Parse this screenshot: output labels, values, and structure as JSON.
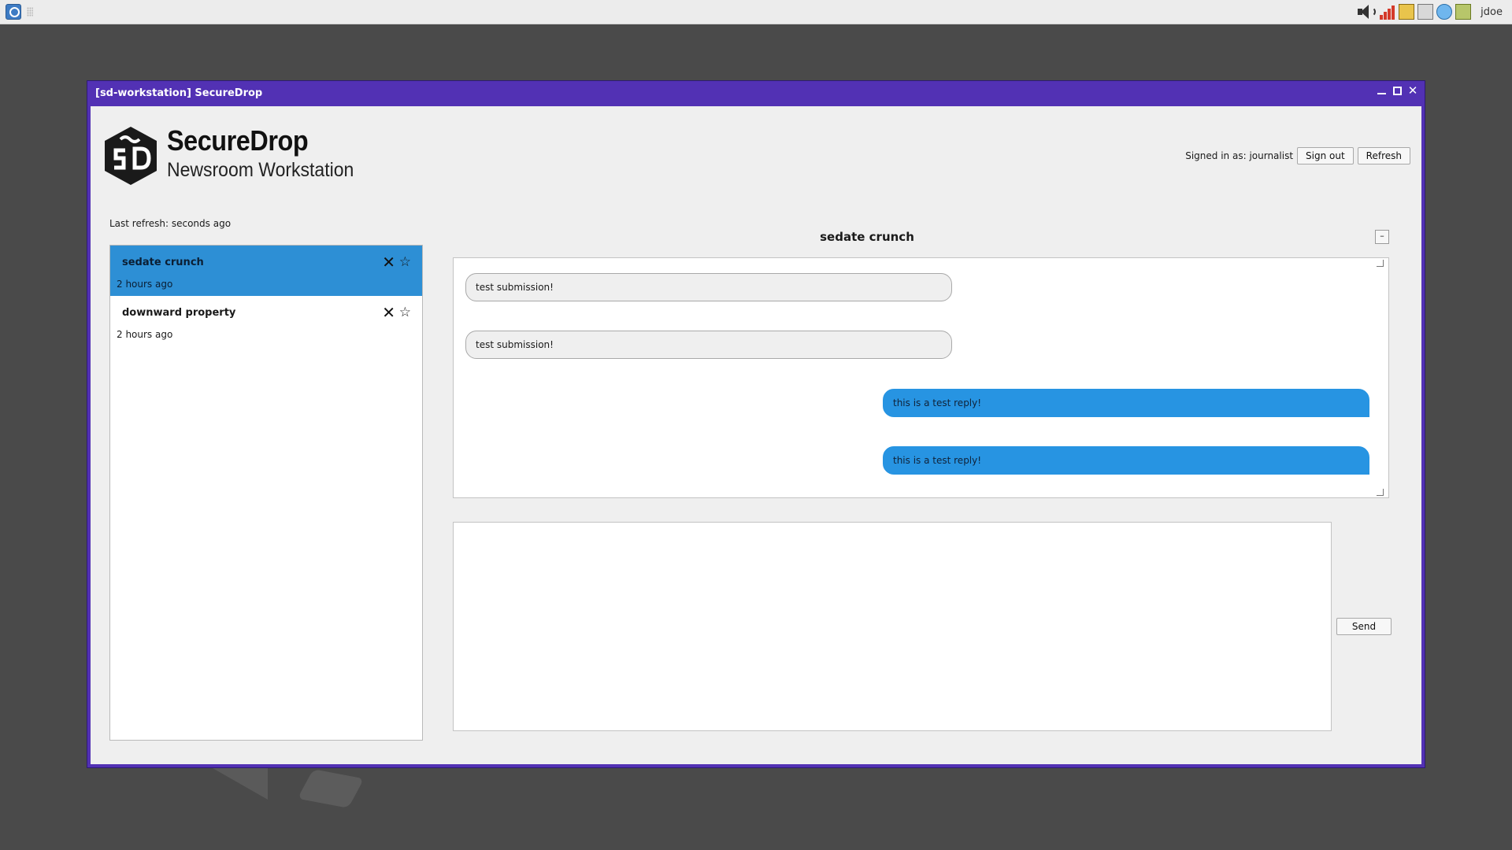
{
  "system_bar": {
    "user": "jdoe",
    "icons": [
      "qubes-launcher-icon",
      "volume-icon",
      "network-bars-icon",
      "devices-icon",
      "disk-icon",
      "updates-icon",
      "domains-icon"
    ]
  },
  "window": {
    "title": "[sd-workstation] SecureDrop"
  },
  "header": {
    "brand_name": "SecureDrop",
    "brand_subtitle": "Newsroom Workstation",
    "signed_in": "Signed in as: journalist",
    "sign_out_label": "Sign out",
    "refresh_label": "Refresh"
  },
  "status": {
    "last_refresh": "Last refresh: seconds ago"
  },
  "sources": [
    {
      "name": "sedate crunch",
      "time": "2 hours ago",
      "selected": true
    },
    {
      "name": "downward property",
      "time": "2 hours ago",
      "selected": false
    }
  ],
  "conversation": {
    "title": "sedate crunch",
    "collapse_label": "–",
    "messages": [
      {
        "type": "submission",
        "text": "test submission!"
      },
      {
        "type": "submission",
        "text": "test submission!"
      },
      {
        "type": "reply",
        "text": "this is a test reply!"
      },
      {
        "type": "reply",
        "text": "this is a test reply!"
      }
    ]
  },
  "reply": {
    "value": "",
    "send_label": "Send"
  },
  "colors": {
    "window_border": "#5231b4",
    "selected_source": "#2d8fd5",
    "reply_bubble": "#2794e2",
    "submission_bubble": "#efefef"
  }
}
